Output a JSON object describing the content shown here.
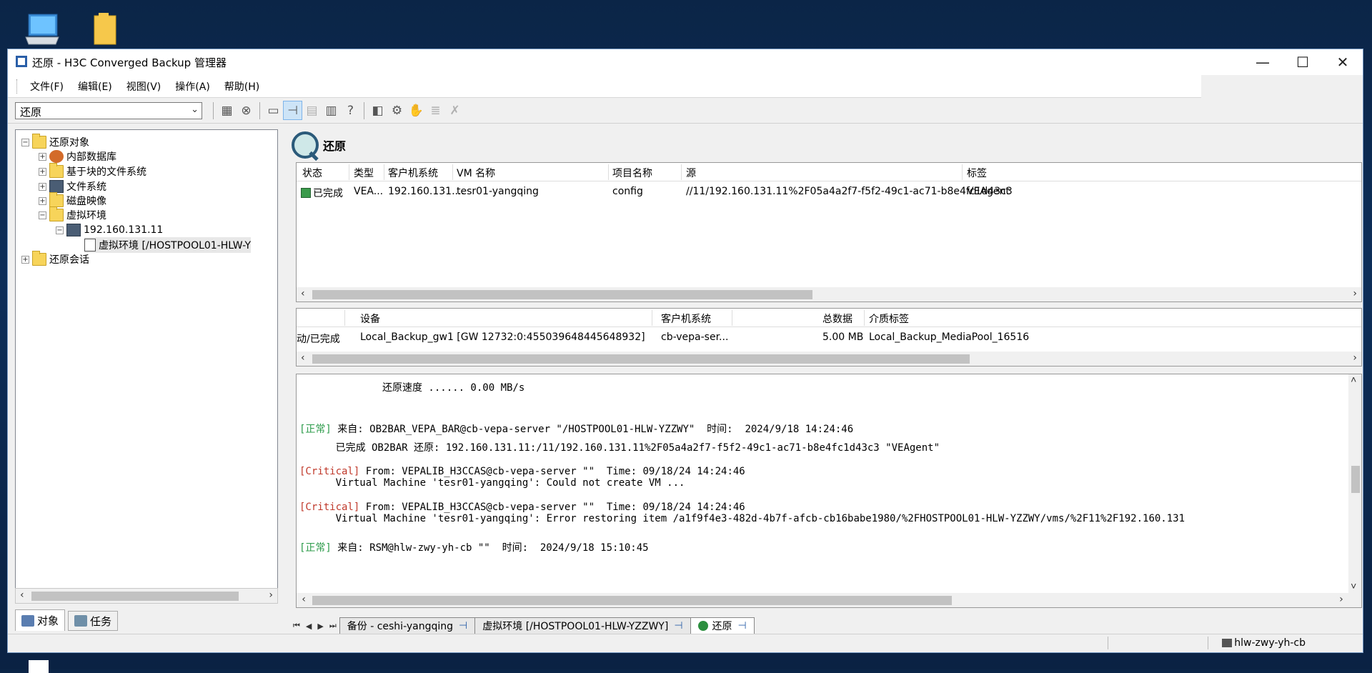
{
  "window": {
    "title": "还原 - H3C Converged Backup 管理器"
  },
  "menu": [
    "文件(F)",
    "编辑(E)",
    "视图(V)",
    "操作(A)",
    "帮助(H)"
  ],
  "toolbar": {
    "context": "还原",
    "help_glyph": "?"
  },
  "tree": {
    "root_restore_objects": "还原对象",
    "internal_db": "内部数据库",
    "block_fs": "基于块的文件系统",
    "file_system": "文件系统",
    "disk_image": "磁盘映像",
    "virtual_env": "虚拟环境",
    "host_ip": "192.160.131.11",
    "virtual_env_item": "虚拟环境 [/HOSTPOOL01-HLW-Y",
    "restore_sessions": "还原会话"
  },
  "left_tabs": [
    "对象",
    "任务"
  ],
  "restore_panel": {
    "title": "还原"
  },
  "objects_table": {
    "columns": [
      "状态",
      "类型",
      "客户机系统",
      "VM 名称",
      "项目名称",
      "源",
      "标签"
    ],
    "rows": [
      [
        "已完成",
        "VEA...",
        "192.160.131....",
        "tesr01-yangqing",
        "config",
        "//11/192.160.131.11%2F05a4a2f7-f5f2-49c1-ac71-b8e4fc1d43c3",
        "VEAgent"
      ]
    ]
  },
  "devices_table": {
    "columns": [
      "设备",
      "客户机系统",
      "总数据",
      "介质标签"
    ],
    "rows": [
      [
        "动/已完成",
        "Local_Backup_gw1 [GW 12732:0:455039648445648932]",
        "cb-vepa-ser...",
        "5.00  MB",
        "Local_Backup_MediaPool_16516"
      ]
    ]
  },
  "log": {
    "speed_line": "还原速度 ...... 0.00 MB/s",
    "entries": [
      {
        "tag": "[正常]",
        "head": " 来自: OB2BAR_VEPA_BAR@cb-vepa-server \"/HOSTPOOL01-HLW-YZZWY\"  时间:  2024/9/18 14:24:46",
        "body": "      已完成 OB2BAR 还原: 192.160.131.11:/11/192.160.131.11%2F05a4a2f7-f5f2-49c1-ac71-b8e4fc1d43c3 \"VEAgent\""
      },
      {
        "tag": "[Critical]",
        "head": " From: VEPALIB_H3CCAS@cb-vepa-server \"\"  Time: 09/18/24 14:24:46",
        "body": "      Virtual Machine 'tesr01-yangqing': Could not create VM ..."
      },
      {
        "tag": "[Critical]",
        "head": " From: VEPALIB_H3CCAS@cb-vepa-server \"\"  Time: 09/18/24 14:24:46",
        "body": "      Virtual Machine 'tesr01-yangqing': Error restoring item /a1f9f4e3-482d-4b7f-afcb-cb16babe1980/%2FHOSTPOOL01-HLW-YZZWY/vms/%2F11%2F192.160.131"
      },
      {
        "tag": "[正常]",
        "head": " 来自: RSM@hlw-zwy-yh-cb \"\"  时间:  2024/9/18 15:10:45",
        "body": ""
      }
    ]
  },
  "bottom_tabs": [
    "备份 - ceshi-yangqing",
    "虚拟环境 [/HOSTPOOL01-HLW-YZZWY]",
    "还原"
  ],
  "status": {
    "host": "hlw-zwy-yh-cb"
  }
}
